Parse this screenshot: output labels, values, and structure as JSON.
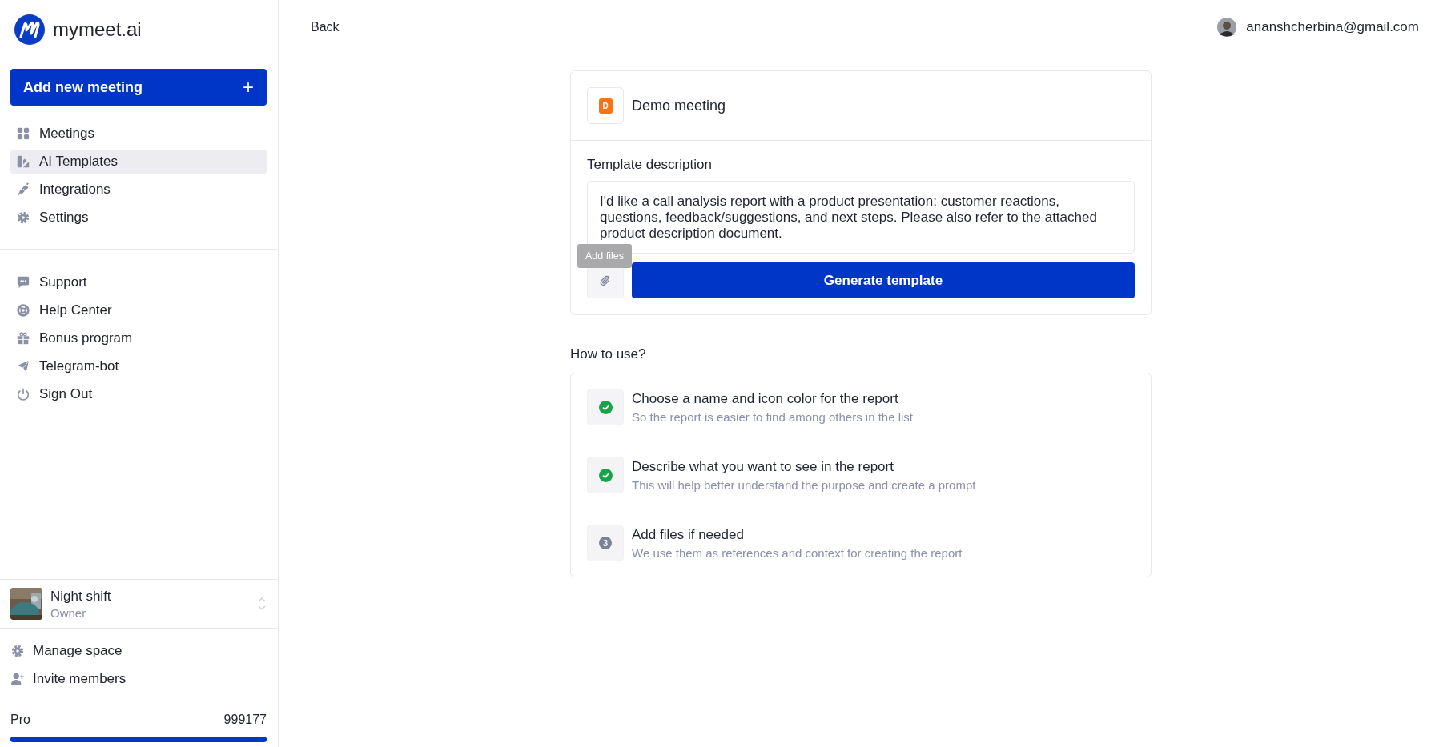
{
  "logo": {
    "text": "mymeet.ai"
  },
  "add_button": {
    "label": "Add new meeting",
    "icon": "+"
  },
  "nav": [
    {
      "label": "Meetings",
      "selected": false
    },
    {
      "label": "AI Templates",
      "selected": true
    },
    {
      "label": "Integrations",
      "selected": false
    },
    {
      "label": "Settings",
      "selected": false
    }
  ],
  "nav_secondary": [
    {
      "label": "Support"
    },
    {
      "label": "Help Center"
    },
    {
      "label": "Bonus program"
    },
    {
      "label": "Telegram-bot"
    },
    {
      "label": "Sign Out"
    }
  ],
  "workspace": {
    "name": "Night shift",
    "role": "Owner"
  },
  "workspace_menu": [
    {
      "label": "Manage space"
    },
    {
      "label": "Invite members"
    }
  ],
  "plan": {
    "name": "Pro",
    "balance": "999177",
    "level": 1
  },
  "header": {
    "back": "Back",
    "email": "ananshcherbina@gmail.com"
  },
  "template": {
    "icon_letter": "D",
    "color": "#f97316",
    "name": "Demo meeting",
    "description_label": "Template description",
    "description": "I'd like a call analysis report with a product presentation: customer reactions, questions, feedback/suggestions, and next steps. Please also refer to the attached product description document.",
    "tooltip": "Add files",
    "generate": "Generate template"
  },
  "how_to": {
    "title": "How to use?",
    "steps": [
      {
        "title": "Choose a name and icon color for the report",
        "subtitle": "So the report is easier to find among others in the list",
        "done": true
      },
      {
        "title": "Describe what you want to see in the report",
        "subtitle": "This will help better understand the purpose and create a prompt",
        "done": true
      },
      {
        "title": "Add files if needed",
        "subtitle": "We use them as references and context for creating the report",
        "done": false,
        "number": "3"
      }
    ]
  }
}
